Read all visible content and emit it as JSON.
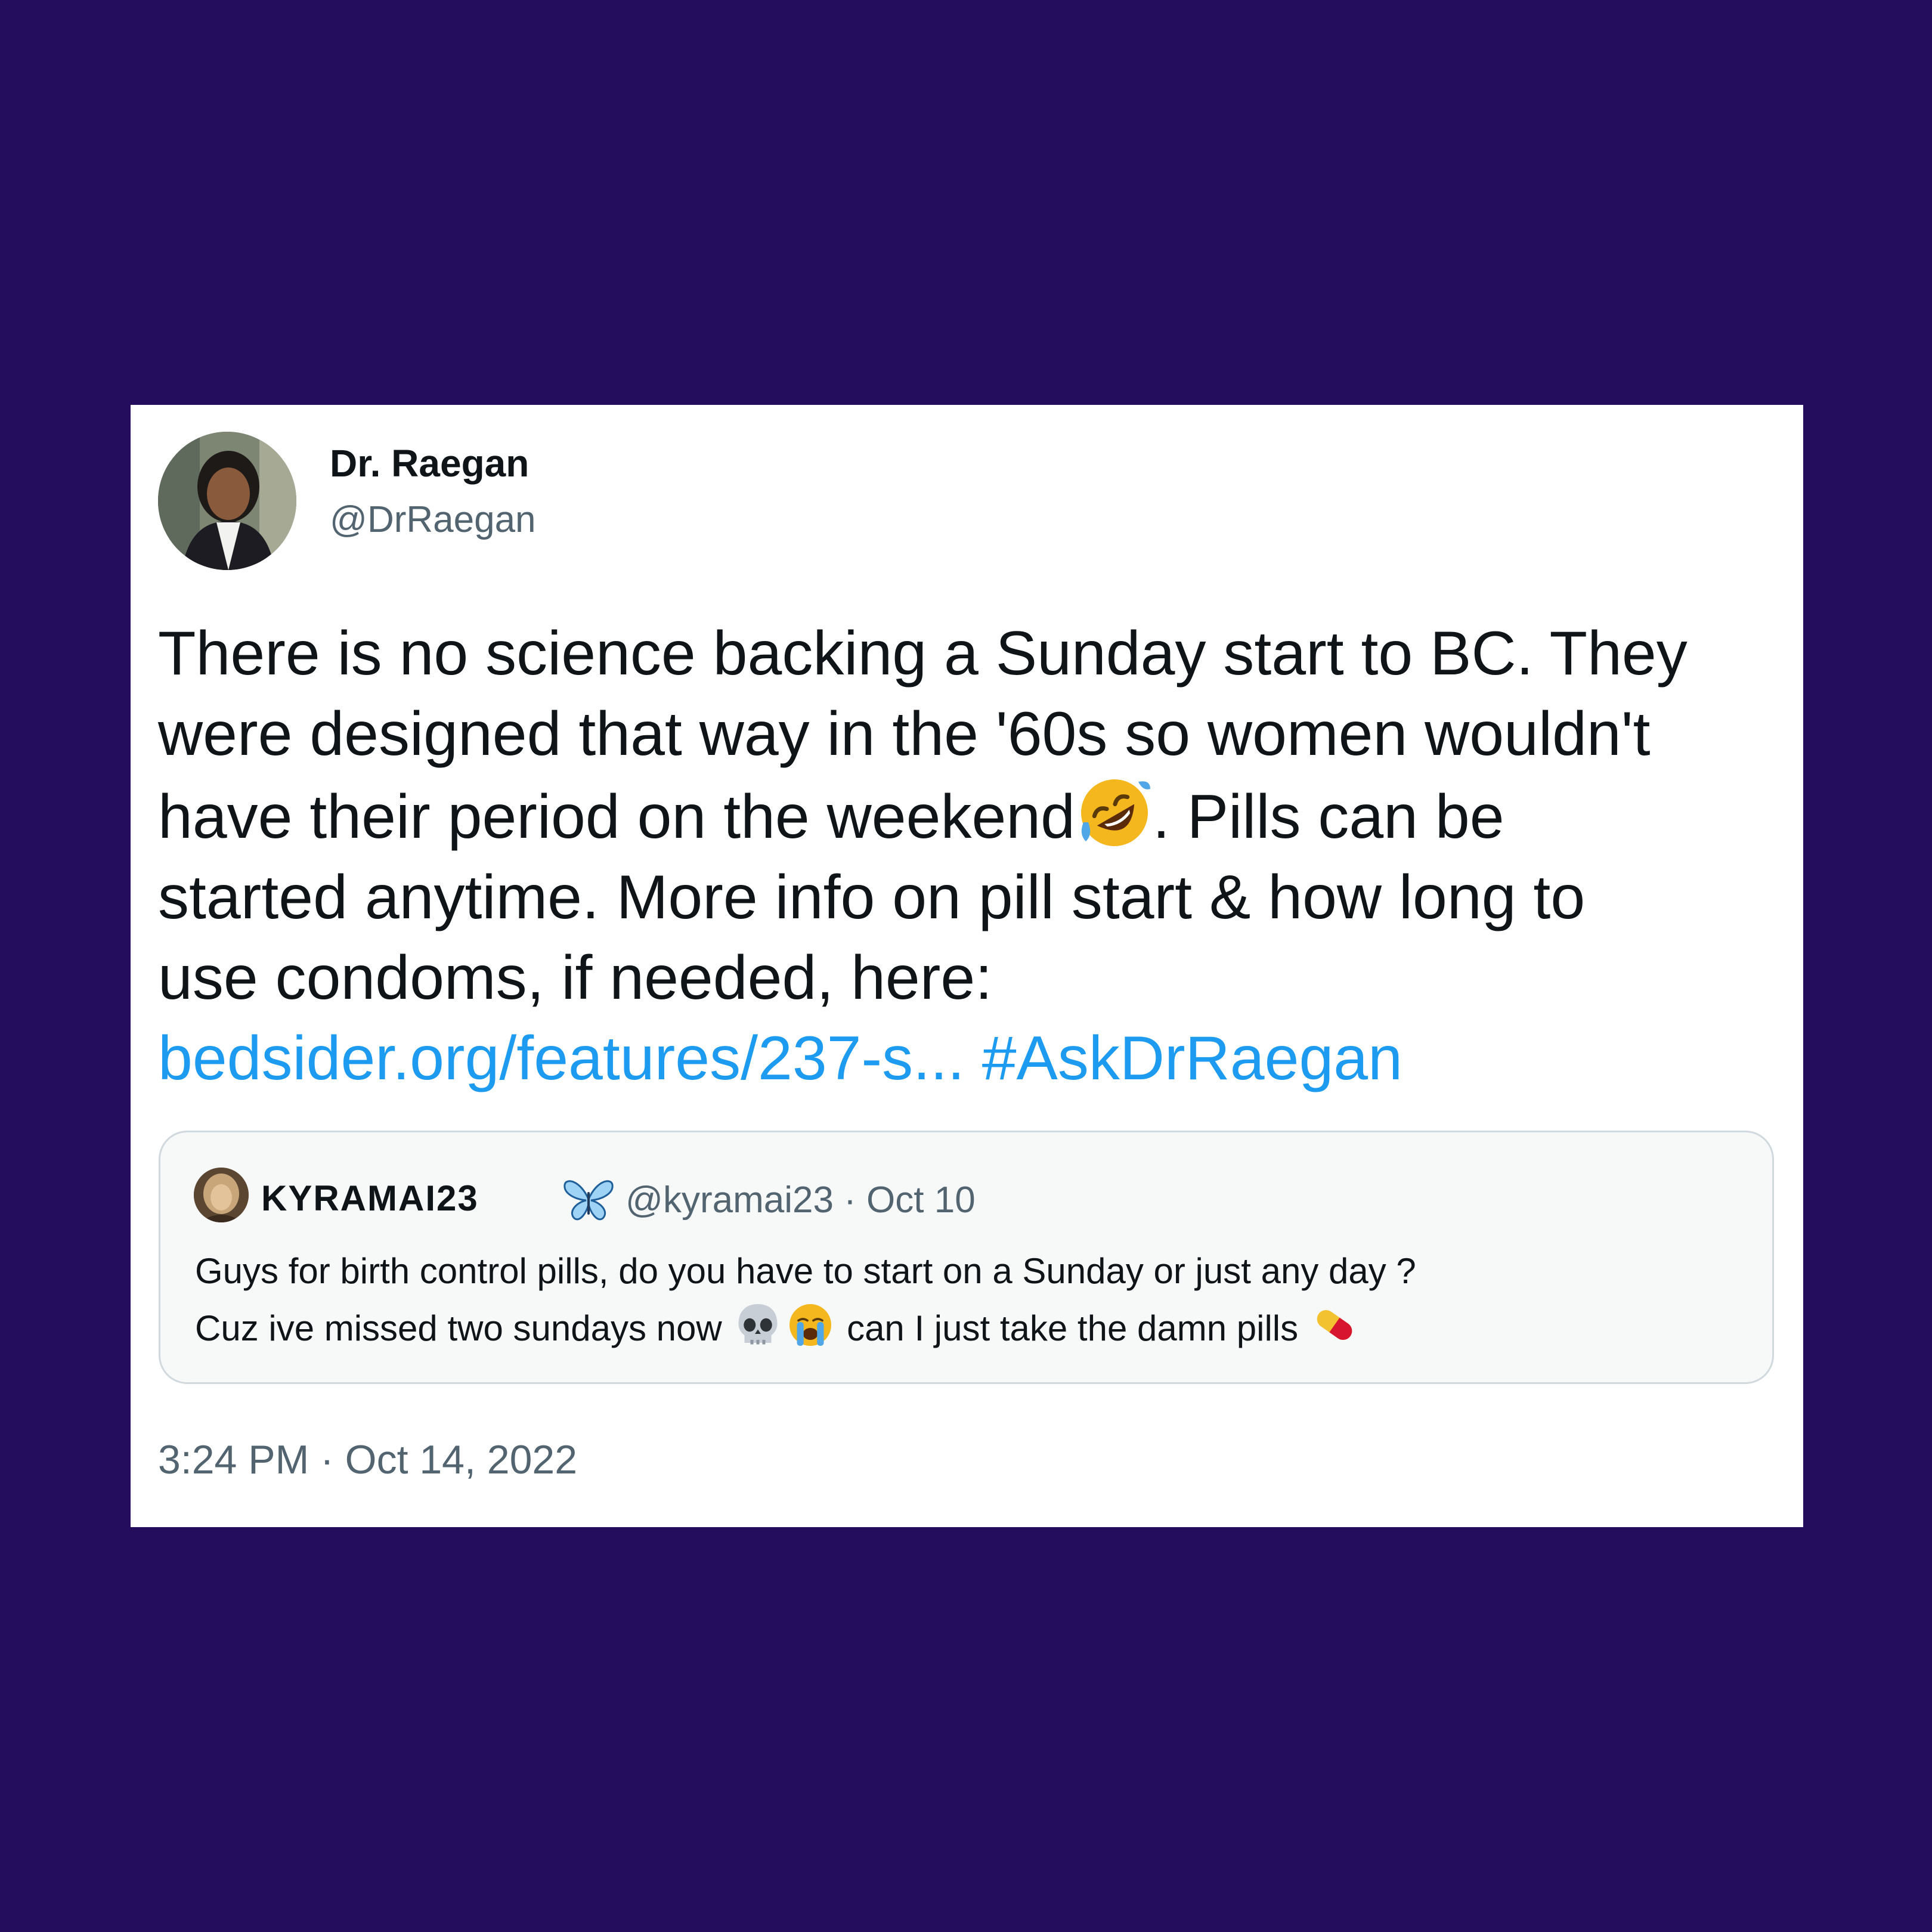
{
  "tweet": {
    "author": {
      "display_name": "Dr. Raegan",
      "handle": "@DrRaegan",
      "avatar": "profile-photo"
    },
    "body": {
      "line1": "There is no science backing a Sunday start to BC. They",
      "line2": "were designed that way in the '60s so women wouldn't",
      "line3_before_emoji": "have their period on the weekend",
      "line3_emoji": "rolling-on-floor-laughing-emoji",
      "line3_after_emoji": ".  Pills can be",
      "line4": "started anytime. More info on pill start & how long to",
      "line5": "use condoms, if needed, here:",
      "link": "bedsider.org/features/237-s...",
      "hashtag": "#AskDrRaegan"
    },
    "quoted_tweet": {
      "display_name": "KYRAMAI23",
      "name_emoji": "butterfly-emoji",
      "meta": "@kyramai23 · Oct 10",
      "line1": "Guys for birth control pills, do you have to start on a Sunday or just any day ?",
      "line2_text": "Cuz ive missed two sundays now",
      "line2_emojis": [
        "skull-emoji",
        "crying-face-emoji"
      ],
      "line2_after": "can I just take the damn pills",
      "line2_end_emoji": "pill-emoji"
    },
    "timestamp": "3:24 PM · Oct 14, 2022"
  },
  "colors": {
    "background": "#250d5e",
    "card": "#ffffff",
    "link": "#1d9bf0",
    "text": "#0f1419",
    "secondary_text": "#536471",
    "quote_border": "#cfd9de"
  }
}
